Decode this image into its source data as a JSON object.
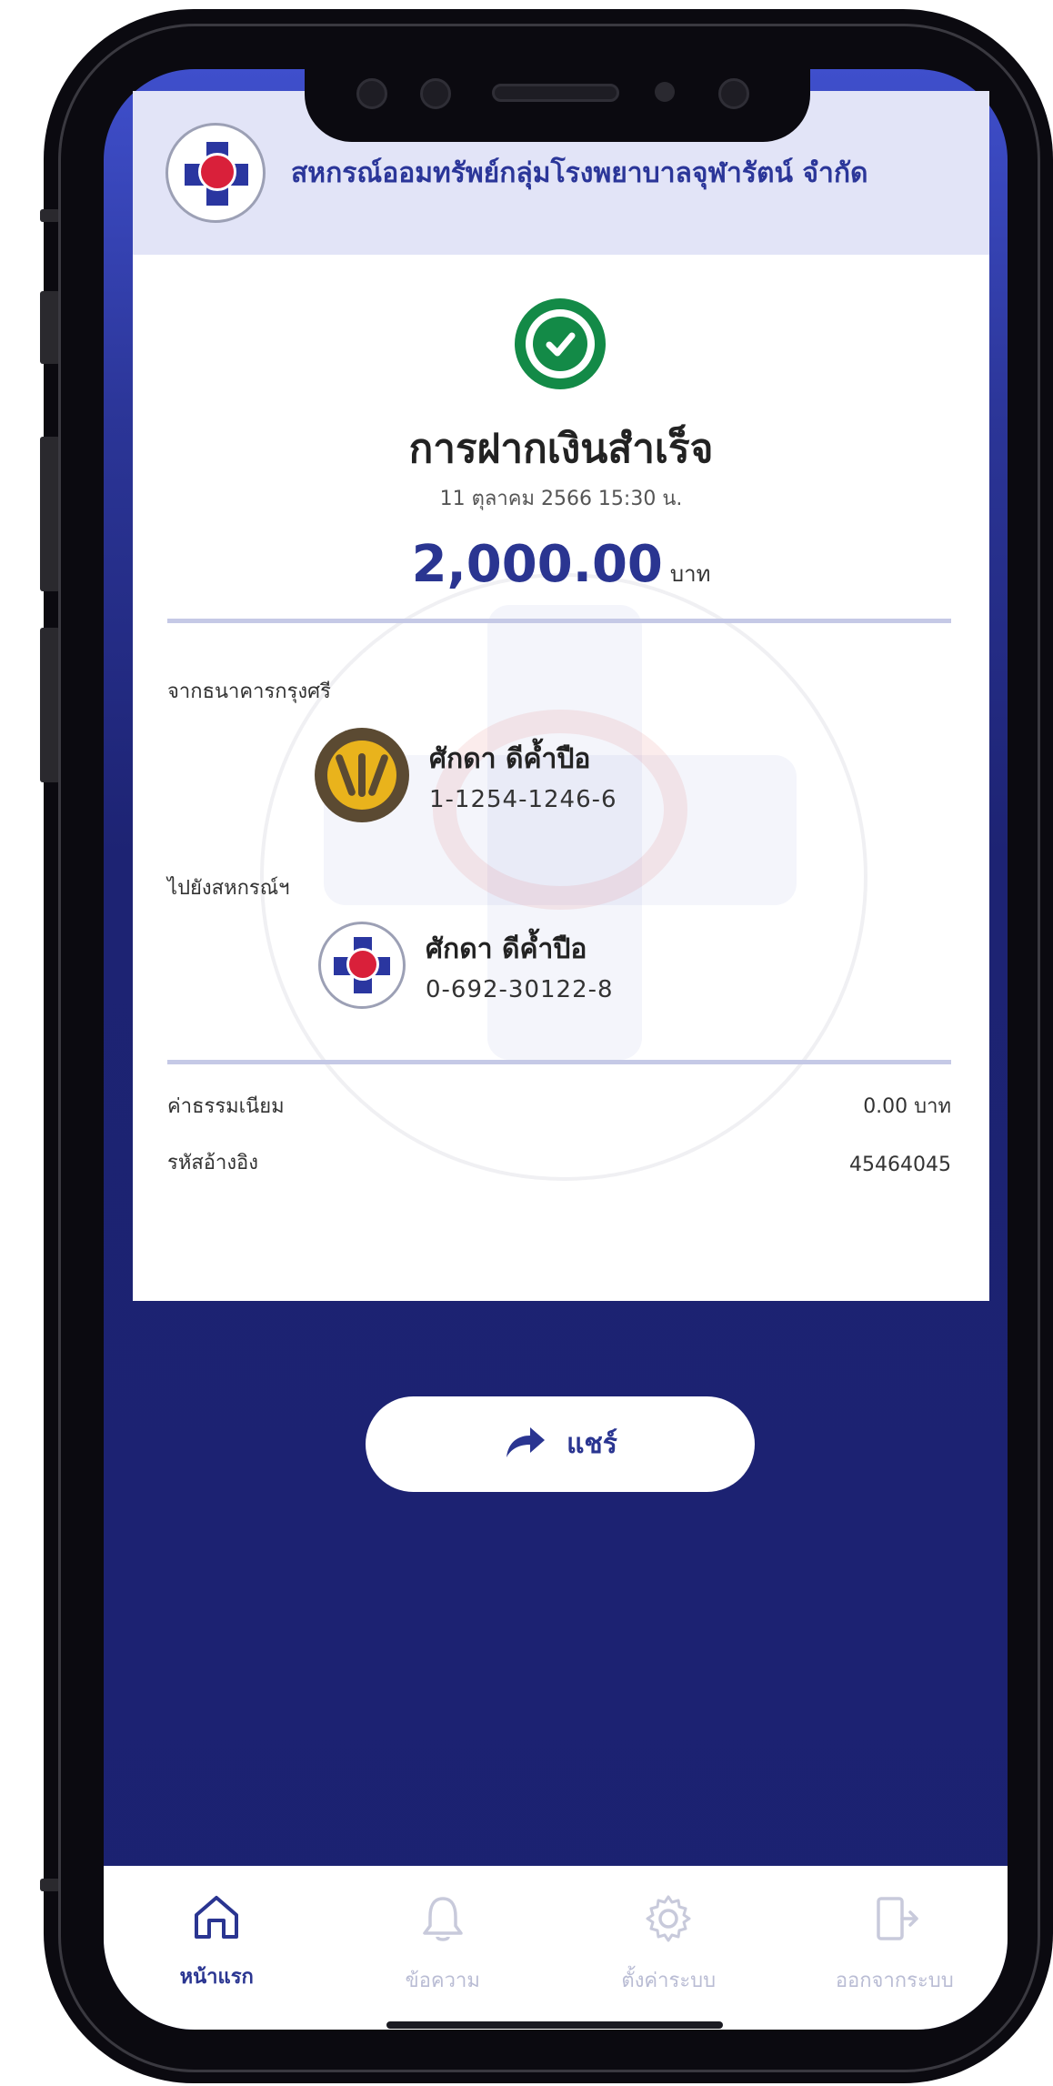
{
  "colors": {
    "brand": "#2a3591",
    "background": "#1b2271",
    "success": "#138a47",
    "header_bg": "#e2e4f7"
  },
  "header": {
    "title": "สหกรณ์ออมทรัพย์กลุ่มโรงพยาบาลจุฬารัตน์ จำกัด",
    "logo_icon": "coop-logo-icon"
  },
  "receipt": {
    "status_icon": "check-circle-icon",
    "title": "การฝากเงินสำเร็จ",
    "datetime": "11 ตุลาคม 2566 15:30 น.",
    "amount": "2,000.00",
    "currency": "บาท",
    "from": {
      "label": "จากธนาคารกรุงศรี",
      "icon": "krungsri-bank-logo",
      "name": "ศักดา ดีค้ำปือ",
      "account": "1-1254-1246-6"
    },
    "to": {
      "label": "ไปยังสหกรณ์ฯ",
      "icon": "coop-logo-icon",
      "name": "ศักดา ดีค้ำปือ",
      "account": "0-692-30122-8"
    },
    "fee": {
      "label": "ค่าธรรมเนียม",
      "value": "0.00 บาท"
    },
    "reference": {
      "label": "รหัสอ้างอิง",
      "value": "45464045"
    }
  },
  "share": {
    "label": "แชร์",
    "icon": "share-arrow-icon"
  },
  "nav": {
    "items": [
      {
        "label": "หน้าแรก",
        "icon": "home-icon",
        "active": true
      },
      {
        "label": "ข้อความ",
        "icon": "bell-icon",
        "active": false
      },
      {
        "label": "ตั้งค่าระบบ",
        "icon": "gear-icon",
        "active": false
      },
      {
        "label": "ออกจากระบบ",
        "icon": "logout-icon",
        "active": false
      }
    ]
  }
}
